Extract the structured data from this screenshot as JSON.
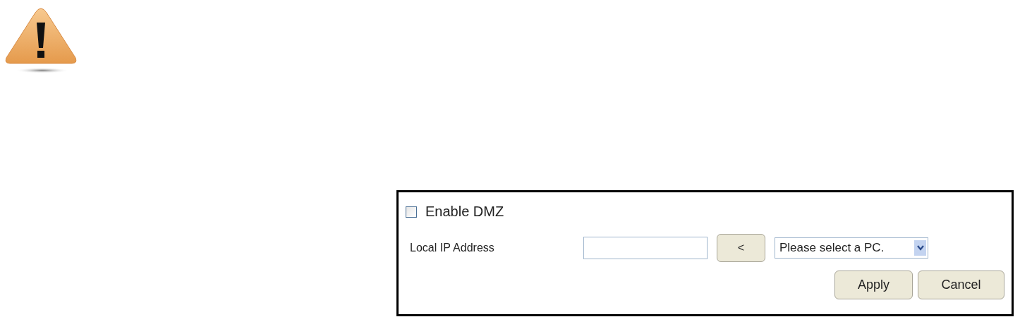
{
  "dmz": {
    "label": "Enable DMZ",
    "checked": false
  },
  "local_ip": {
    "label": "Local IP Address",
    "pick_button": "<",
    "select": "Please select a PC."
  },
  "buttons": [
    "Apply",
    "Cancel"
  ]
}
